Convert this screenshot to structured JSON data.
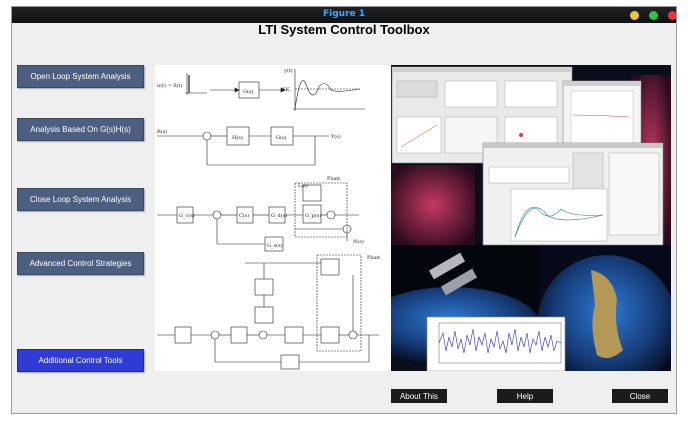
{
  "window": {
    "title": "Figure 1"
  },
  "app": {
    "heading": "LTI System Control Toolbox"
  },
  "sidebar": {
    "buttons": [
      {
        "label": "Open Loop System Analysis"
      },
      {
        "label": "Analysis Based On G(s)H(s)"
      },
      {
        "label": "Close Loop System Analysis"
      },
      {
        "label": "Advanced Control Strategies"
      },
      {
        "label": "Additional Control Tools"
      }
    ]
  },
  "footer": {
    "about_label": "About This",
    "help_label": "Help",
    "close_label": "Close"
  },
  "diagram": {
    "input_label": "u(t) = δ(t)",
    "block_g": "G(s)",
    "response_axis": "y(t)",
    "kk": "KK",
    "h_block": "H(s)",
    "r_label": "R(s)",
    "y_label": "Y(s)",
    "plant_label": "Plant",
    "plant_label2": "Plant",
    "gp_block": "G_p(s)",
    "gc_block": "G_c(s)",
    "gd_block": "G_d(s)",
    "c_block": "C(s)",
    "d_label": "L(s)",
    "n_label": "N(s)",
    "gs_block": "G_s(s)"
  },
  "colors": {
    "accent": "#2f3bd6",
    "button": "#4d5f80",
    "title_blue": "#3ba7ff"
  }
}
